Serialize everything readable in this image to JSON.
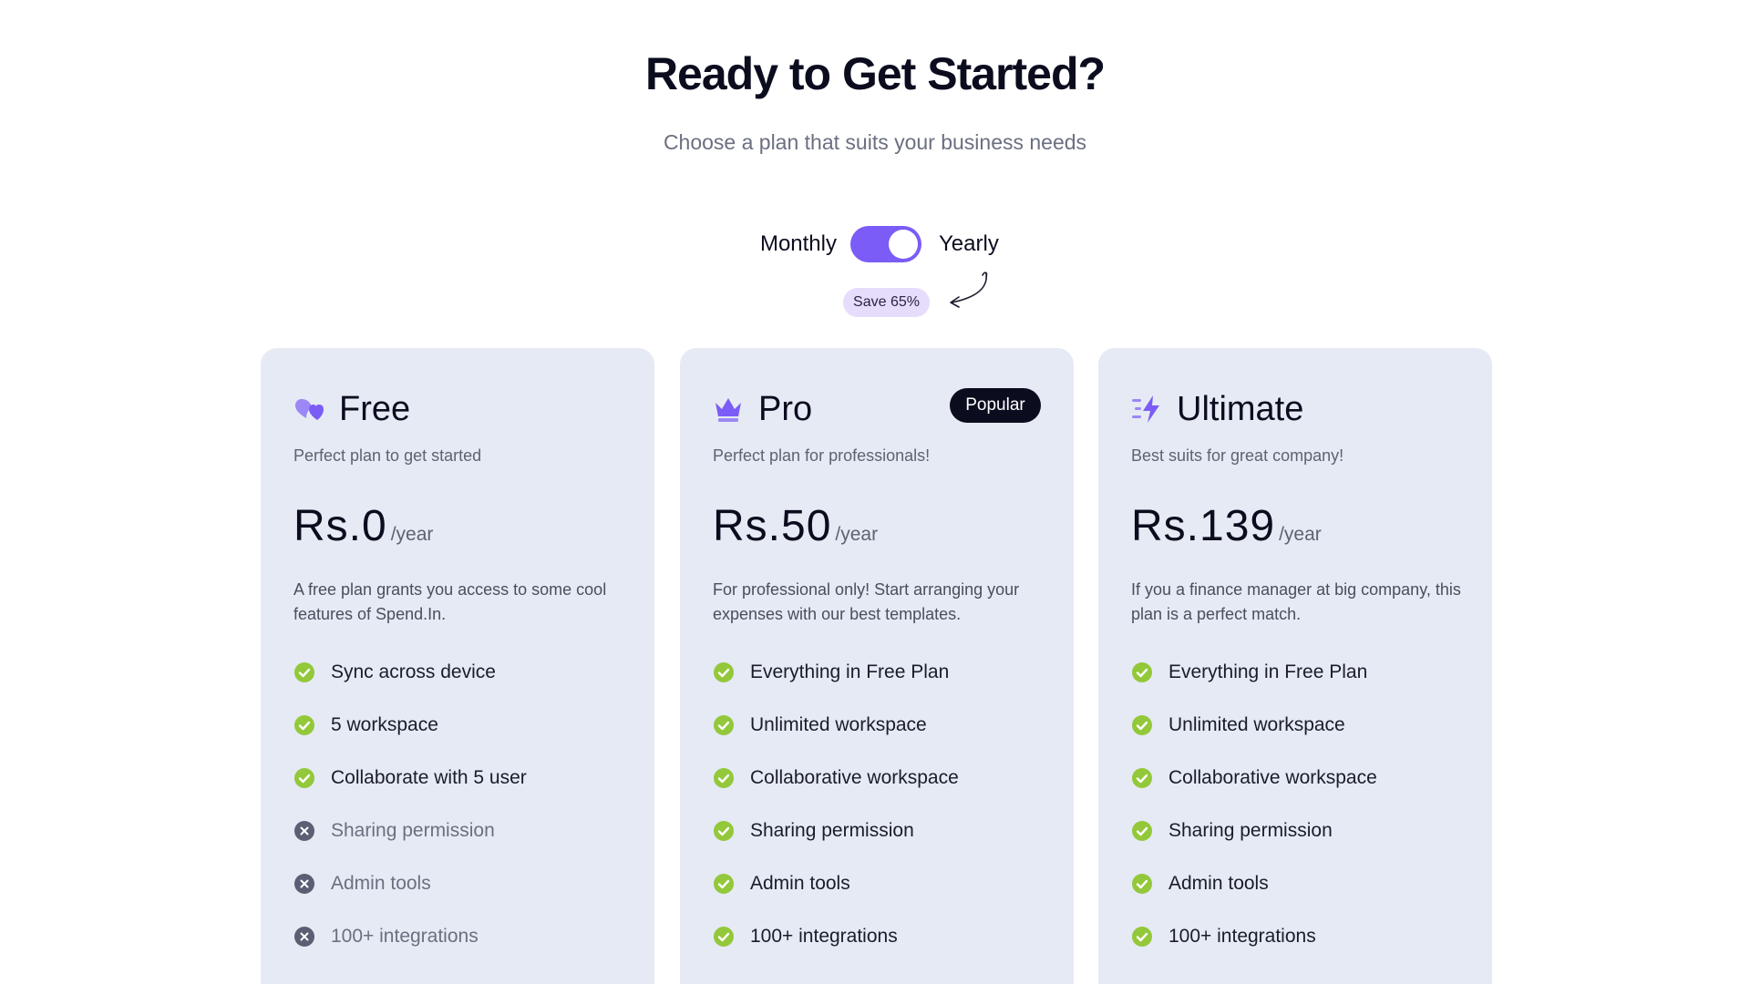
{
  "header": {
    "title": "Ready to Get Started?",
    "subtitle": "Choose a plan that suits your business needs"
  },
  "billing_toggle": {
    "left_label": "Monthly",
    "right_label": "Yearly",
    "selected": "Yearly",
    "save_badge": "Save 65%"
  },
  "colors": {
    "accent": "#7b5cf6",
    "card_bg": "#e5eaf4",
    "check": "#93c83a",
    "cross": "#5a5f73"
  },
  "plans": [
    {
      "name": "Free",
      "icon": "hearts-icon",
      "tagline": "Perfect plan to get started",
      "price": "Rs.0",
      "period": "/year",
      "description": "A free plan grants you access to some cool features of Spend.In.",
      "features": [
        {
          "label": "Sync across device",
          "included": true
        },
        {
          "label": "5 workspace",
          "included": true
        },
        {
          "label": "Collaborate with 5 user",
          "included": true
        },
        {
          "label": "Sharing permission",
          "included": false
        },
        {
          "label": "Admin tools",
          "included": false
        },
        {
          "label": "100+ integrations",
          "included": false
        }
      ]
    },
    {
      "name": "Pro",
      "icon": "crown-icon",
      "badge": "Popular",
      "tagline": "Perfect plan for professionals!",
      "price": "Rs.50",
      "period": "/year",
      "description": "For professional only! Start arranging your expenses with our best templates.",
      "features": [
        {
          "label": "Everything in Free Plan",
          "included": true
        },
        {
          "label": "Unlimited workspace",
          "included": true
        },
        {
          "label": "Collaborative workspace",
          "included": true
        },
        {
          "label": "Sharing permission",
          "included": true
        },
        {
          "label": "Admin tools",
          "included": true
        },
        {
          "label": "100+ integrations",
          "included": true
        }
      ]
    },
    {
      "name": "Ultimate",
      "icon": "lightning-icon",
      "tagline": "Best suits for great company!",
      "price": "Rs.139",
      "period": "/year",
      "description": "If you a finance manager at big company, this plan is a perfect match.",
      "features": [
        {
          "label": "Everything in Free Plan",
          "included": true
        },
        {
          "label": "Unlimited workspace",
          "included": true
        },
        {
          "label": "Collaborative workspace",
          "included": true
        },
        {
          "label": "Sharing permission",
          "included": true
        },
        {
          "label": "Admin tools",
          "included": true
        },
        {
          "label": "100+ integrations",
          "included": true
        }
      ]
    }
  ]
}
